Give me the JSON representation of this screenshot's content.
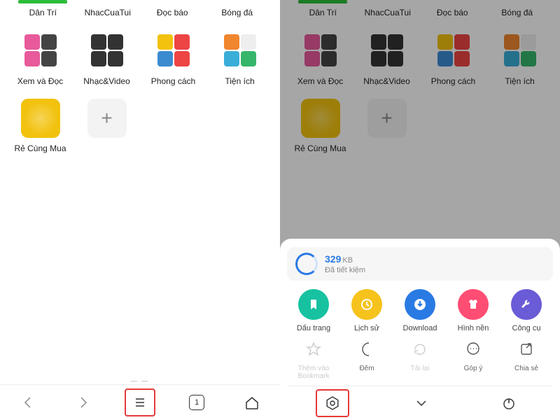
{
  "topTabs": [
    {
      "label": "Dân Trí",
      "barColor": "green"
    },
    {
      "label": "NhacCuaTui"
    },
    {
      "label": "Đọc báo"
    },
    {
      "label": "Bóng đá"
    }
  ],
  "folders": [
    {
      "name": "Xem và Đọc",
      "tiles": [
        "#e85a9b",
        "#444",
        "#e85a9b",
        "#444"
      ]
    },
    {
      "name": "Nhạc&Video",
      "tiles": [
        "#333",
        "#333",
        "#333",
        "#333"
      ]
    },
    {
      "name": "Phong cách",
      "tiles": [
        "#f2c20f",
        "#e44",
        "#3b8bd1",
        "#e44"
      ]
    },
    {
      "name": "Tiện ích",
      "tiles": [
        "#f0862e",
        "#eee",
        "#3aaed8",
        "#35b56a"
      ]
    }
  ],
  "singleApp": {
    "name": "Rẻ Cùng Mua",
    "color": "#f2c20f"
  },
  "tabCount": "1",
  "saved": {
    "value": "329",
    "unit": "KB",
    "label": "Đã tiết kiệm"
  },
  "menu1": [
    {
      "label": "Dấu trang",
      "color": "#17c2a0",
      "icon": "bookmark"
    },
    {
      "label": "Lịch sử",
      "color": "#f6c21c",
      "icon": "clock"
    },
    {
      "label": "Download",
      "color": "#2a7ae4",
      "icon": "down"
    },
    {
      "label": "Hình nền",
      "color": "#ff4d73",
      "icon": "shirt"
    },
    {
      "label": "Công cụ",
      "color": "#6a5bd6",
      "icon": "wrench"
    }
  ],
  "menu2": [
    {
      "label": "Thêm vào Bookmark",
      "icon": "star",
      "disabled": true
    },
    {
      "label": "Đêm",
      "icon": "moon"
    },
    {
      "label": "Tải lại",
      "icon": "reload",
      "disabled": true
    },
    {
      "label": "Góp ý",
      "icon": "comment"
    },
    {
      "label": "Chia sẻ",
      "icon": "share"
    }
  ]
}
